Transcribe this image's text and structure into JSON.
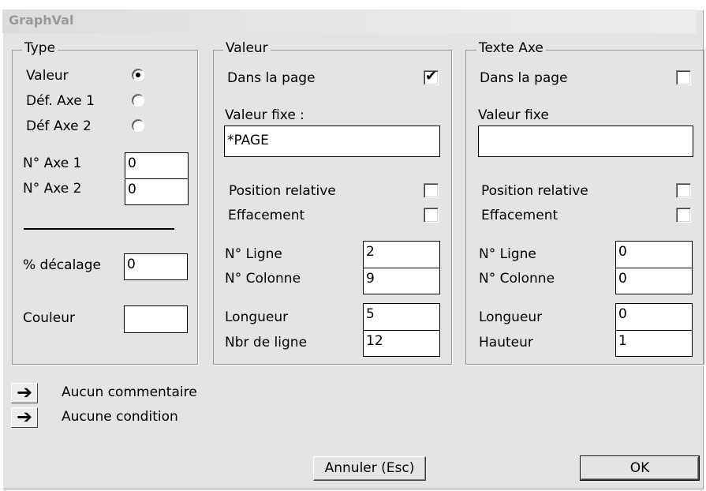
{
  "window": {
    "title": "GraphVal"
  },
  "type_group": {
    "legend": "Type",
    "radios": [
      {
        "label": "Valeur",
        "checked": true
      },
      {
        "label": "Déf. Axe 1",
        "checked": false
      },
      {
        "label": "Déf Axe 2",
        "checked": false
      }
    ],
    "axe1_label": "N° Axe 1",
    "axe1_value": "0",
    "axe2_label": "N° Axe 2",
    "axe2_value": "0",
    "decalage_label": "% décalage",
    "decalage_value": "0",
    "couleur_label": "Couleur"
  },
  "valeur_group": {
    "legend": "Valeur",
    "dans_page_label": "Dans la page",
    "dans_page_checked": true,
    "valeur_fixe_label": "Valeur fixe :",
    "valeur_fixe_value": "*PAGE",
    "position_relative_label": "Position relative",
    "effacement_label": "Effacement",
    "ligne_label": "N° Ligne",
    "ligne_value": "2",
    "colonne_label": "N° Colonne",
    "colonne_value": "9",
    "longueur_label": "Longueur",
    "longueur_value": "5",
    "nbr_ligne_label": "Nbr de ligne",
    "nbr_ligne_value": "12"
  },
  "texte_axe_group": {
    "legend": "Texte Axe",
    "dans_page_label": "Dans la  page",
    "valeur_fixe_label": "Valeur fixe",
    "valeur_fixe_value": "",
    "position_relative_label": "Position relative",
    "effacement_label": "Effacement",
    "ligne_label": "N° Ligne",
    "ligne_value": "0",
    "colonne_label": "N° Colonne",
    "colonne_value": "0",
    "longueur_label": "Longueur",
    "longueur_value": "0",
    "hauteur_label": "Hauteur",
    "hauteur_value": "1"
  },
  "footer": {
    "comment_label": "Aucun commentaire",
    "condition_label": "Aucune condition",
    "arrow_glyph": "➔",
    "cancel_label": "Annuler (Esc)",
    "ok_label": "OK"
  },
  "icons": {
    "arrow": "arrow-right-icon",
    "check": "checkmark-icon"
  }
}
